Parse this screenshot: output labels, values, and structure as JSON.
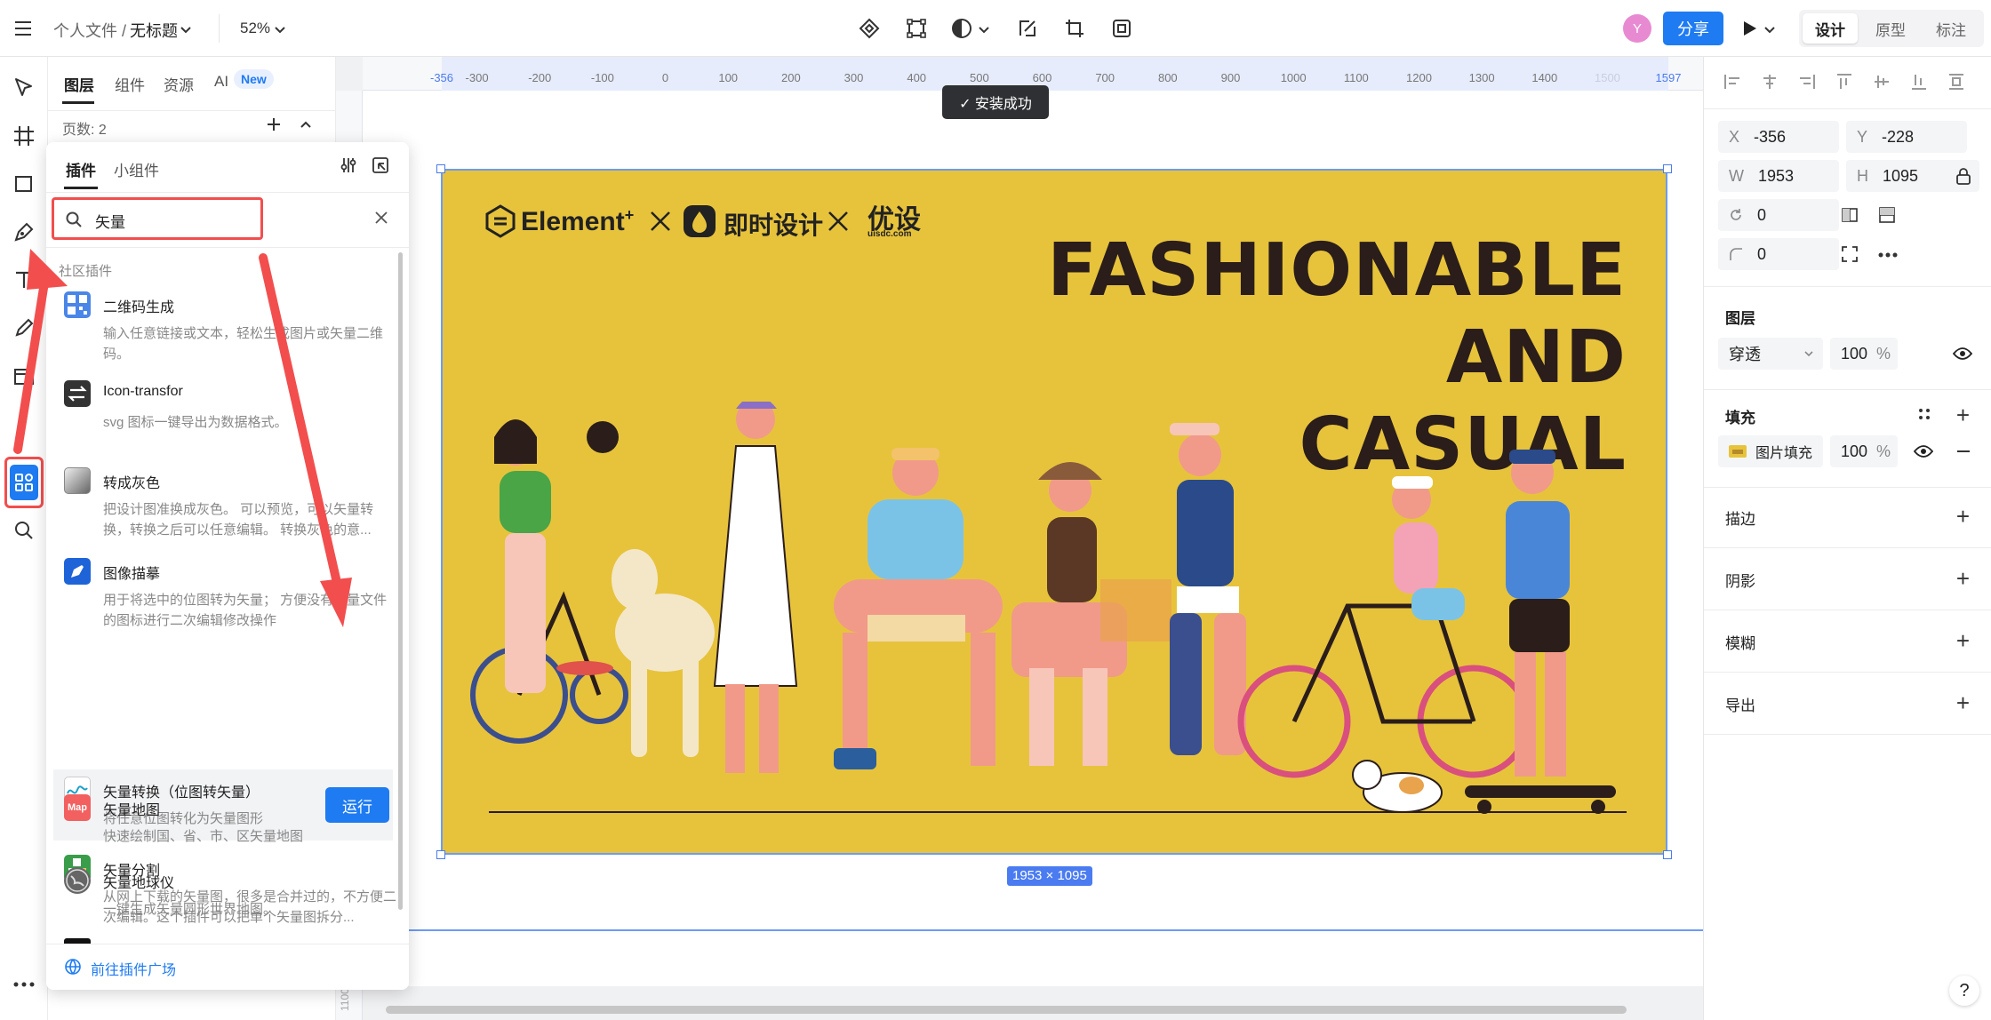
{
  "topbar": {
    "breadcrumb_parent": "个人文件 /",
    "file_name": "无标题",
    "zoom": "52%",
    "avatar": "Y",
    "share_label": "分享",
    "tabs": [
      "设计",
      "原型",
      "标注"
    ]
  },
  "left_panel": {
    "tabs": [
      "图层",
      "组件",
      "资源",
      "AI"
    ],
    "new_badge": "New",
    "pages_label": "页数: 2"
  },
  "plugin_popup": {
    "tabs": [
      "插件",
      "小组件"
    ],
    "search_value": "矢量",
    "section_label": "社区插件",
    "items": [
      {
        "name": "二维码生成",
        "desc": "输入任意链接或文本，轻松生成图片或矢量二维码。"
      },
      {
        "name": "Icon-transfor",
        "desc": "svg 图标一键导出为数据格式。"
      },
      {
        "name": "转成灰色",
        "desc": "把设计图准换成灰色。 可以预览，可以矢量转换，转换之后可以任意编辑。 转换灰色的意..."
      },
      {
        "name": "图像描摹",
        "desc": "用于将选中的位图转为矢量； 方便没有矢量文件的图标进行二次编辑修改操作"
      },
      {
        "name": "矢量转换（位图转矢量）",
        "desc": "将任意位图转化为矢量图形"
      },
      {
        "name": "矢量分割",
        "desc": "从网上下载的矢量图，很多是合并过的，不方便二次编辑。这个插件可以把单个矢量图拆分..."
      },
      {
        "name": "矢量地图",
        "desc": "快速绘制国、省、市、区矢量地图"
      },
      {
        "name": "矢量地球仪",
        "desc": "一键生成矢量圆形世界地图。"
      }
    ],
    "run_label": "运行",
    "map_icon_text": "Map",
    "footer_link": "前往插件广场"
  },
  "canvas": {
    "ruler_ticks": [
      "-356",
      "-300",
      "-200",
      "-100",
      "0",
      "100",
      "200",
      "300",
      "400",
      "500",
      "600",
      "700",
      "800",
      "900",
      "1000",
      "1100",
      "1200",
      "1300",
      "1400",
      "1500",
      "1597"
    ],
    "ruler_v_label": "1100",
    "toast": "✓ 安装成功",
    "size_badge": "1953 × 1095",
    "artwork": {
      "brand1": "Element",
      "brand1_sup": "+",
      "brand2": "即时设计",
      "brand3": "优设",
      "brand3_sub": "uisdc.com",
      "headline": [
        "FASHIONABLE",
        "AND",
        "CASUAL"
      ],
      "bg_color": "#e7c33c"
    }
  },
  "right_panel": {
    "x_label": "X",
    "x_value": "-356",
    "y_label": "Y",
    "y_value": "-228",
    "w_label": "W",
    "w_value": "1953",
    "h_label": "H",
    "h_value": "1095",
    "rotation": "0",
    "radius": "0",
    "layer_title": "图层",
    "blend_mode": "穿透",
    "opacity": "100",
    "percent": "%",
    "fill_title": "填充",
    "fill_type": "图片填充",
    "fill_opacity": "100",
    "stroke_title": "描边",
    "shadow_title": "阴影",
    "blur_title": "模糊",
    "export_title": "导出",
    "help": "?"
  },
  "colors": {
    "accent": "#1a73e8",
    "share_bg": "#1e7bf2",
    "annotation_red": "#f24e4e"
  }
}
